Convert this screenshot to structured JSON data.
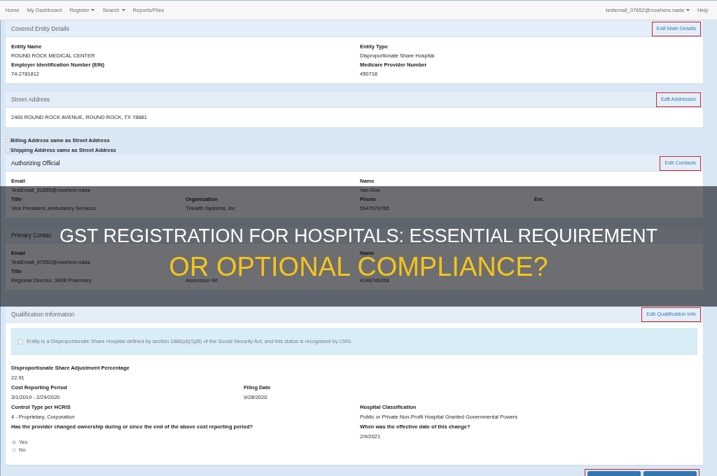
{
  "nav": {
    "left": [
      {
        "label": "Home",
        "dropdown": false
      },
      {
        "label": "My Dashboard",
        "dropdown": false
      },
      {
        "label": "Register",
        "dropdown": true
      },
      {
        "label": "Search",
        "dropdown": true
      },
      {
        "label": "Reports/Files",
        "dropdown": false
      }
    ],
    "right": [
      {
        "label": "testemail_07652@nowhere.nada",
        "dropdown": true
      },
      {
        "label": "Help",
        "dropdown": false
      }
    ]
  },
  "sections": [
    {
      "kind": "entity",
      "title": "Covered Entity Details",
      "action": {
        "label": "Edit Main Details",
        "highlighted": true
      },
      "rows": [
        {
          "cells": [
            {
              "label": "Entity Name",
              "value": "ROUND ROCK MEDICAL CENTER"
            },
            {
              "label": "Entity Type",
              "value": "Disproportionate Share Hospital"
            }
          ]
        },
        {
          "cells": [
            {
              "label": "Employer Identification Number (EIN)",
              "value": "74-2781812"
            },
            {
              "label": "Medicare Provider Number",
              "value": "450718"
            }
          ]
        }
      ]
    },
    {
      "kind": "address",
      "title": "Street Address",
      "action": {
        "label": "Edit Addresses",
        "highlighted": true
      },
      "text": "2400 ROUND ROCK AVENUE, ROUND ROCK, TX 78681"
    },
    {
      "kind": "checks",
      "items": [
        {
          "label": "Billing Address same as Street Address",
          "checked": false
        },
        {
          "label": "Shipping Address same as Street Address",
          "checked": false
        }
      ]
    },
    {
      "kind": "contact",
      "title": "Authorizing Official",
      "action": {
        "label": "Edit Contacts",
        "highlighted": true
      },
      "rows": [
        {
          "cells": [
            {
              "label": "Email",
              "value": "TestEmail_51855@nowhere.nada"
            },
            "",
            {
              "label": "Name",
              "value": "Van Doe"
            }
          ]
        },
        {
          "cells": [
            {
              "label": "Title",
              "value": "Vice President, Ambulatory Services"
            },
            {
              "label": "Organization",
              "value": "THealth Systems, Inc"
            },
            {
              "label": "Phone",
              "value": "5647676765"
            },
            {
              "label": "Ext."
            }
          ]
        }
      ]
    },
    {
      "kind": "contact",
      "title": "Primary Contac",
      "rows": [
        {
          "cells": [
            {
              "label": "Email",
              "value": "TestEmail_07652@nowhere.nada"
            },
            "",
            {
              "label": "Name"
            }
          ]
        },
        {
          "cells": [
            {
              "label": "Title",
              "value": "Regional Director, 340B Pharmacy"
            },
            {
              "value": "Ascension WI"
            },
            {
              "value": "4148746268"
            }
          ]
        }
      ]
    },
    {
      "kind": "qualification",
      "title": "Qualification Information",
      "action": {
        "label": "Edit Qualification Info",
        "highlighted": true
      },
      "notice": {
        "checked": false,
        "text": "Entity is a Disproportionate Share Hospital defined by section 1886(d)(1)(B) of the Social Security Act, and this status is recognized by CMS."
      },
      "rows": [
        {
          "cells": [
            {
              "label": "Disproportionate Share Adjustment Percentage",
              "value": "22.91"
            }
          ]
        },
        {
          "cells": [
            {
              "label": "Cost Reporting Period",
              "value": "3/1/2019 - 2/29/2020"
            },
            {
              "label": "Filing Date",
              "value": "9/28/2020"
            }
          ]
        },
        {
          "cells": [
            {
              "label": "Control Type per HCRIS",
              "value": "4 - Proprietary, Corporation"
            },
            {
              "label": "Hospital Classification",
              "value": "Public or Private Non-Profit Hospital Granted Governmental Powers"
            }
          ]
        },
        {
          "cells": [
            {
              "label": "Has the provider changed ownership during or since the end of the above cost reporting period?",
              "options": [
                {
                  "label": "Yes",
                  "selected": true
                },
                {
                  "label": "No",
                  "selected": false
                }
              ]
            },
            {
              "label": "When was the effective date of this change?",
              "value": "2/9/2021"
            }
          ]
        }
      ]
    }
  ],
  "footer": {
    "highlighted": true,
    "buttons": [
      {
        "kind": "primary"
      },
      {
        "kind": "primary"
      }
    ]
  },
  "banner": {
    "lines": [
      {
        "kind": "main",
        "text": "GST REGISTRATION FOR HOSPITALS: ESSENTIAL REQUIREMENT"
      },
      {
        "kind": "accent",
        "text": "OR OPTIONAL COMPLIANCE?"
      }
    ]
  }
}
